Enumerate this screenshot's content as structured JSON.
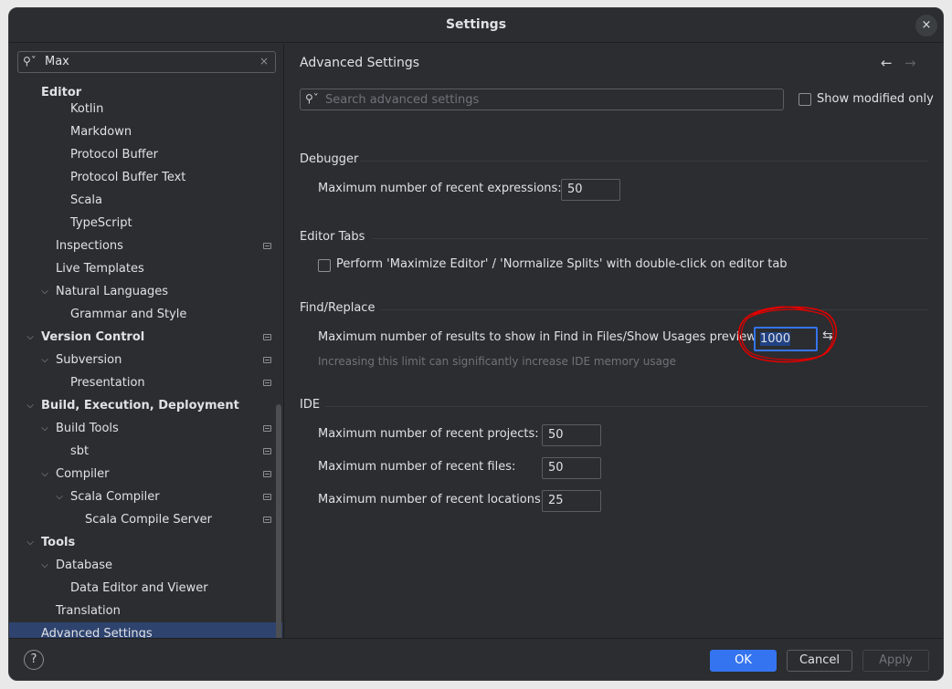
{
  "window": {
    "title": "Settings",
    "close_label": "×"
  },
  "sidebar": {
    "search_value": "Max",
    "clear_icon": "×",
    "items": [
      {
        "label": "Editor",
        "level": 0,
        "bold": true,
        "expanded": null,
        "modified": false
      },
      {
        "label": "Kotlin",
        "level": 2,
        "bold": false,
        "expanded": null,
        "modified": false
      },
      {
        "label": "Markdown",
        "level": 2,
        "bold": false,
        "expanded": null,
        "modified": false
      },
      {
        "label": "Protocol Buffer",
        "level": 2,
        "bold": false,
        "expanded": null,
        "modified": false
      },
      {
        "label": "Protocol Buffer Text",
        "level": 2,
        "bold": false,
        "expanded": null,
        "modified": false
      },
      {
        "label": "Scala",
        "level": 2,
        "bold": false,
        "expanded": null,
        "modified": false
      },
      {
        "label": "TypeScript",
        "level": 2,
        "bold": false,
        "expanded": null,
        "modified": false
      },
      {
        "label": "Inspections",
        "level": 1,
        "bold": false,
        "expanded": null,
        "modified": true
      },
      {
        "label": "Live Templates",
        "level": 1,
        "bold": false,
        "expanded": null,
        "modified": false
      },
      {
        "label": "Natural Languages",
        "level": 1,
        "bold": false,
        "expanded": true,
        "modified": false
      },
      {
        "label": "Grammar and Style",
        "level": 2,
        "bold": false,
        "expanded": null,
        "modified": false
      },
      {
        "label": "Version Control",
        "level": 0,
        "bold": true,
        "expanded": true,
        "modified": true
      },
      {
        "label": "Subversion",
        "level": 1,
        "bold": false,
        "expanded": true,
        "modified": true
      },
      {
        "label": "Presentation",
        "level": 2,
        "bold": false,
        "expanded": null,
        "modified": true
      },
      {
        "label": "Build, Execution, Deployment",
        "level": 0,
        "bold": true,
        "expanded": true,
        "modified": false
      },
      {
        "label": "Build Tools",
        "level": 1,
        "bold": false,
        "expanded": true,
        "modified": true
      },
      {
        "label": "sbt",
        "level": 2,
        "bold": false,
        "expanded": null,
        "modified": true
      },
      {
        "label": "Compiler",
        "level": 1,
        "bold": false,
        "expanded": true,
        "modified": true
      },
      {
        "label": "Scala Compiler",
        "level": 2,
        "bold": false,
        "expanded": true,
        "modified": true
      },
      {
        "label": "Scala Compile Server",
        "level": 3,
        "bold": false,
        "expanded": null,
        "modified": true
      },
      {
        "label": "Tools",
        "level": 0,
        "bold": true,
        "expanded": true,
        "modified": false
      },
      {
        "label": "Database",
        "level": 1,
        "bold": false,
        "expanded": true,
        "modified": false
      },
      {
        "label": "Data Editor and Viewer",
        "level": 2,
        "bold": false,
        "expanded": null,
        "modified": false
      },
      {
        "label": "Translation",
        "level": 1,
        "bold": false,
        "expanded": null,
        "modified": false
      },
      {
        "label": "Advanced Settings",
        "level": 0,
        "bold": false,
        "expanded": null,
        "modified": false,
        "selected": true
      }
    ]
  },
  "content": {
    "title": "Advanced Settings",
    "back_icon": "←",
    "forward_icon": "→",
    "search_placeholder": "Search advanced settings",
    "show_modified_label": "Show modified only",
    "show_modified_checked": false,
    "debugger": {
      "header": "Debugger",
      "recent_expressions_label": "Maximum number of recent expressions:",
      "recent_expressions_value": "50"
    },
    "editor_tabs": {
      "header": "Editor Tabs",
      "maximize_label": "Perform 'Maximize Editor' / 'Normalize Splits' with double-click on editor tab",
      "maximize_checked": false
    },
    "find_replace": {
      "header": "Find/Replace",
      "max_results_label": "Maximum number of results to show in Find in Files/Show Usages preview:",
      "max_results_value": "1000",
      "hint": "Increasing this limit can significantly increase IDE memory usage",
      "reset_icon": "⇆"
    },
    "ide": {
      "header": "IDE",
      "recent_projects_label": "Maximum number of recent projects:",
      "recent_projects_value": "50",
      "recent_files_label": "Maximum number of recent files:",
      "recent_files_value": "50",
      "recent_locations_label": "Maximum number of recent locations:",
      "recent_locations_value": "25"
    }
  },
  "footer": {
    "help_label": "?",
    "ok_label": "OK",
    "cancel_label": "Cancel",
    "apply_label": "Apply"
  },
  "colors": {
    "background": "#2b2d30",
    "accent": "#3574f0",
    "selection": "#2e436e",
    "annotation": "#e00000"
  }
}
